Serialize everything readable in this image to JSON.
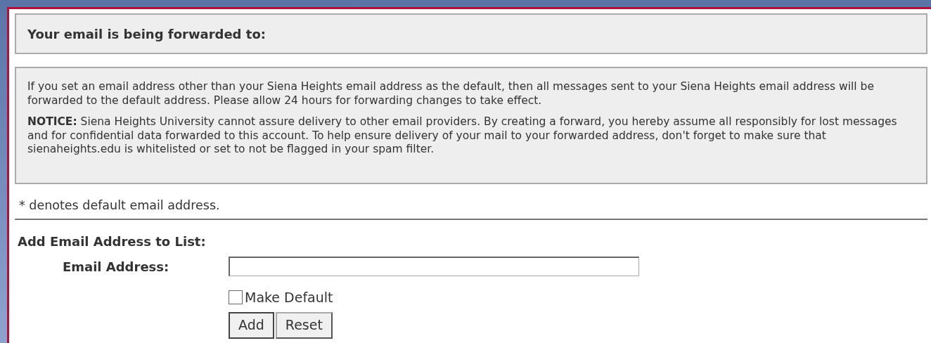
{
  "forward_notice": {
    "label": "Your email is being forwarded to:"
  },
  "info": {
    "paragraphs": [
      "If you set an email address other than your Siena Heights email address as the default, then all messages sent to your Siena Heights email address will be forwarded to the default address. Please allow 24 hours for forwarding changes to take effect.",
      "**NOTICE:** Siena Heights University cannot assure delivery to other email providers. By creating a forward, you hereby assume all responsibly for lost messages and for confidential data forwarded to this account. To help ensure delivery of your mail to your forwarded address, don't forget to make sure that sienaheights.edu is whitelisted or set to not be flagged in your spam filter."
    ]
  },
  "default_note": "* denotes default email address.",
  "add_form": {
    "heading": "Add Email Address to List:",
    "email_label": "Email Address:",
    "make_default": {
      "label": "Make Default",
      "checked": false
    },
    "buttons": [
      "Add",
      "Reset"
    ]
  }
}
